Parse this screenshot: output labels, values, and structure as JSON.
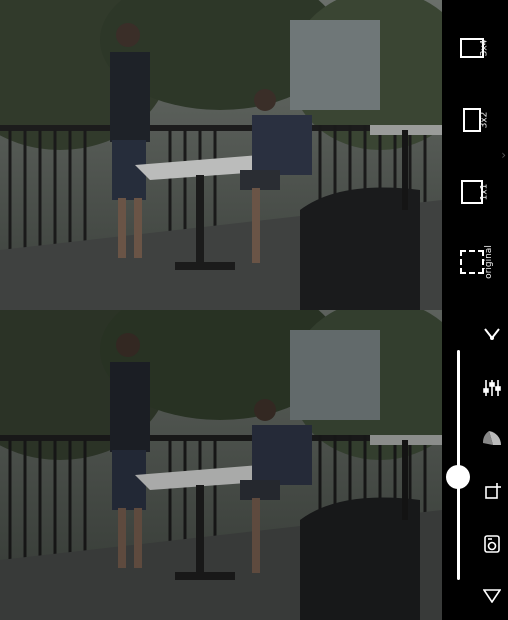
{
  "crop_options": [
    {
      "label": "3x4",
      "icon": "portrait-rect-icon"
    },
    {
      "label": "3x2",
      "icon": "rect-icon"
    },
    {
      "label": "1x1",
      "icon": "square-icon"
    },
    {
      "label": "original",
      "icon": "dashed-square-icon"
    }
  ],
  "tools": {
    "collapse_icon": "chevron-down-icon",
    "adjust_icon": "sliders-icon",
    "tone_icon": "fan-icon",
    "crop_icon": "crop-icon",
    "camera_icon": "camera-icon",
    "expand_icon": "triangle-down-icon"
  },
  "slider": {
    "level": 0.45
  },
  "colors": {
    "rail_bg": "#000000",
    "icon": "#ffffff"
  }
}
